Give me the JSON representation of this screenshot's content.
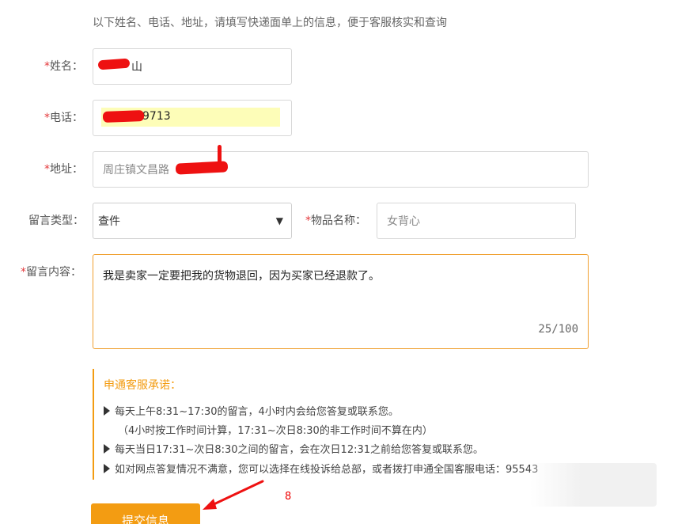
{
  "intro_text": "以下姓名、电话、地址，请填写快递面单上的信息，便于客服核实和查询",
  "required_mark": "*",
  "form": {
    "name": {
      "label": "姓名：",
      "value": "山"
    },
    "phone": {
      "label": "电话：",
      "value": "9713"
    },
    "address": {
      "label": "地址：",
      "value": "周庄镇文昌路"
    },
    "message_type": {
      "label": "留言类型：",
      "value": "查件",
      "dropdown_glyph": "▼"
    },
    "item_name": {
      "label": "物品名称：",
      "value": "女背心"
    },
    "message_content": {
      "label": "留言内容：",
      "value": "我是卖家一定要把我的货物退回，因为买家已经退款了。",
      "counter": "25/100"
    }
  },
  "promise": {
    "title": "申通客服承诺：",
    "items": [
      "每天上午8:31~17:30的留言，4小时内会给您答复或联系您。",
      "（4小时按工作时间计算，17:31~次日8:30的非工作时间不算在内）",
      "每天当日17:31~次日8:30之间的留言，会在次日12:31之前给您答复或联系您。",
      "如对网点答复情况不满意，您可以选择在线投诉给总部，或者拨打申通全国客服电话：95543"
    ]
  },
  "submit_label": "提交信息",
  "annotation_number": "8",
  "colors": {
    "accent": "#f39c12",
    "required": "#e4393c",
    "annotation": "#ee1111"
  }
}
